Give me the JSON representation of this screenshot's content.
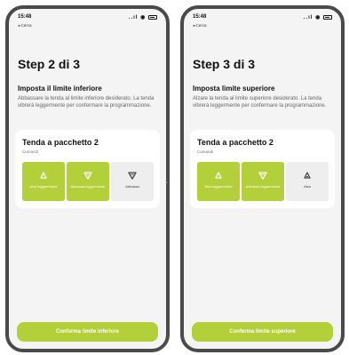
{
  "screens": [
    {
      "status_time": "15:48",
      "status_icons": "..ıl ◉",
      "back_label": "◂ Cerca",
      "step_title": "Step 2 di 3",
      "section_title": "Imposta il limite inferiore",
      "section_desc": "Abbassare la tenda al limite inferiore desiderato. La tenda vibrerà leggermente per confermare la programmazione.",
      "card_title": "Tenda a pacchetto 2",
      "card_sub": "Comandi",
      "commands": [
        {
          "label": "Alza leggermente",
          "icon": "bell-up-icon",
          "state": "active"
        },
        {
          "label": "Abbassa leggermente",
          "icon": "down-arrow-icon",
          "state": "active"
        },
        {
          "label": "Abbassa",
          "icon": "down-arrow-icon",
          "state": "inactive"
        }
      ],
      "confirm_label": "Conferma limite inferiore"
    },
    {
      "status_time": "15:48",
      "status_icons": "..ıl ◉",
      "back_label": "◂ Cerca",
      "step_title": "Step 3 di 3",
      "section_title": "Imposta limite superiore",
      "section_desc": "Alzare la tenda al limite superiore desiderato. La tenda vibrerà leggermente per confermare la programmazione.",
      "card_title": "Tenda a pacchetto 2",
      "card_sub": "Comandi",
      "commands": [
        {
          "label": "Alza leggermente",
          "icon": "bell-up-icon",
          "state": "active"
        },
        {
          "label": "Abbassa leggermente",
          "icon": "down-arrow-icon",
          "state": "active"
        },
        {
          "label": "Alza",
          "icon": "up-arrow-icon",
          "state": "inactive"
        }
      ],
      "confirm_label": "Conferma limite superiore"
    }
  ],
  "colors": {
    "accent": "#b3cf3a",
    "frame": "#4a4a4a",
    "screen_bg": "#f4f4f4"
  }
}
